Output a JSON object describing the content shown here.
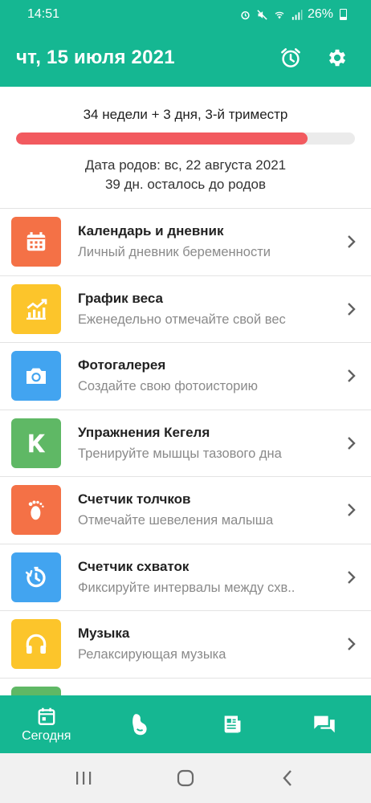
{
  "status": {
    "time": "14:51",
    "battery": "26%"
  },
  "header": {
    "date": "чт, 15 июля 2021",
    "icons": [
      "alarm-icon",
      "gear-icon"
    ]
  },
  "summary": {
    "weeks": "34 недели + 3 дня, 3-й триместр",
    "progress": 0.86,
    "due_date": "Дата родов: вс, 22 августа 2021",
    "days_left": "39 дн. осталось до родов"
  },
  "colors": {
    "brand": "#15b792",
    "progress": "#f25a5f"
  },
  "menu": [
    {
      "title": "Календарь и дневник",
      "subtitle": "Личный дневник беременности",
      "icon": "calendar-icon",
      "color": "#f47146"
    },
    {
      "title": "График веса",
      "subtitle": "Еженедельно отмечайте свой вес",
      "icon": "chart-icon",
      "color": "#fcc52b"
    },
    {
      "title": "Фотогалерея",
      "subtitle": "Создайте свою фотоисторию",
      "icon": "camera-icon",
      "color": "#42a4f0"
    },
    {
      "title": "Упражнения Кегеля",
      "subtitle": "Тренируйте мышцы тазового дна",
      "icon": "kegel-k-icon",
      "color": "#5fb865"
    },
    {
      "title": "Счетчик толчков",
      "subtitle": "Отмечайте шевеления малыша",
      "icon": "footprint-icon",
      "color": "#f47146"
    },
    {
      "title": "Счетчик схваток",
      "subtitle": "Фиксируйте интервалы между схв..",
      "icon": "timer-icon",
      "color": "#42a4f0"
    },
    {
      "title": "Музыка",
      "subtitle": "Релаксирующая музыка",
      "icon": "headphones-icon",
      "color": "#fcc52b"
    },
    {
      "title": "",
      "subtitle": "",
      "icon": "",
      "color": "#5fb865"
    }
  ],
  "bottom_nav": {
    "today_label": "Сегодня",
    "tabs": [
      "calendar-icon",
      "baby-icon",
      "articles-icon",
      "chat-icon"
    ]
  }
}
